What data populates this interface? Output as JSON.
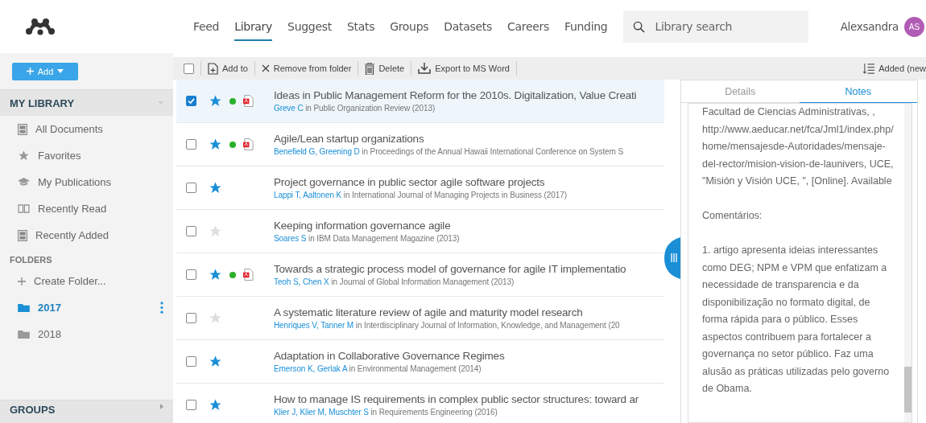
{
  "nav": {
    "items": [
      {
        "label": "Feed",
        "selected": false
      },
      {
        "label": "Library",
        "selected": true
      },
      {
        "label": "Suggest",
        "selected": false
      },
      {
        "label": "Stats",
        "selected": false
      },
      {
        "label": "Groups",
        "selected": false
      },
      {
        "label": "Datasets",
        "selected": false
      },
      {
        "label": "Careers",
        "selected": false
      },
      {
        "label": "Funding",
        "selected": false
      }
    ],
    "search": {
      "placeholder": "Library search"
    },
    "user": {
      "name": "Alexsandra",
      "initials": "AS"
    }
  },
  "add_button": "Add",
  "sidebar": {
    "my_library": {
      "title": "MY LIBRARY",
      "items": [
        "All Documents",
        "Favorites",
        "My Publications",
        "Recently Read",
        "Recently Added"
      ]
    },
    "folders": {
      "title": "FOLDERS",
      "create": "Create Folder...",
      "items": [
        {
          "label": "2017",
          "selected": true
        },
        {
          "label": "2018",
          "selected": false
        }
      ]
    },
    "groups": {
      "title": "GROUPS"
    }
  },
  "toolbar": {
    "select_all": {
      "checked": false
    },
    "actions": [
      "Add to",
      "Remove from folder",
      "Delete",
      "Export to MS Word"
    ],
    "sort": "Added (new"
  },
  "rows": [
    {
      "title": "Ideas in Public Management Reform for the 2010s. Digitalization, Value Creati",
      "authors": "Greve C",
      "source": "in Public Organization Review (2013)",
      "selected": true,
      "starred": true,
      "unread": true,
      "pdf": true
    },
    {
      "title": "Agile/Lean startup organizations",
      "authors": "Benefield G, Greening D",
      "source": "in Proceedings of the Annual Hawaii International Conference on System S",
      "selected": false,
      "starred": true,
      "unread": true,
      "pdf": true
    },
    {
      "title": "Project governance in public sector agile software projects",
      "authors": "Lappi T, Aaltonen K",
      "source": "in International Journal of Managing Projects in Business (2017)",
      "selected": false,
      "starred": true,
      "unread": false,
      "pdf": false
    },
    {
      "title": "Keeping information governance agile",
      "authors": "Soares S",
      "source": "in IBM Data Management Magazine (2013)",
      "selected": false,
      "starred": false,
      "unread": false,
      "pdf": false
    },
    {
      "title": "Towards a strategic process model of governance for agile IT implementatio",
      "authors": "Teoh S, Chen X",
      "source": "in Journal of Global Information Management (2013)",
      "selected": false,
      "starred": true,
      "unread": true,
      "pdf": true
    },
    {
      "title": "A systematic literature review of agile and maturity model research",
      "authors": "Henriques V, Tanner M",
      "source": "in Interdisciplinary Journal of Information, Knowledge, and Management (20",
      "selected": false,
      "starred": false,
      "unread": false,
      "pdf": false
    },
    {
      "title": "Adaptation in Collaborative Governance Regimes",
      "authors": "Emerson K, Gerlak A",
      "source": "in Environmental Management (2014)",
      "selected": false,
      "starred": true,
      "unread": false,
      "pdf": false
    },
    {
      "title": "How to manage IS requirements in complex public sector structures: toward ar",
      "authors": "Klier J, Klier M, Muschter S",
      "source": "in Requirements Engineering (2016)",
      "selected": false,
      "starred": true,
      "unread": false,
      "pdf": false
    }
  ],
  "panel": {
    "tabs": [
      {
        "label": "Details",
        "selected": false
      },
      {
        "label": "Notes",
        "selected": true
      }
    ],
    "notes": [
      "Facultad de Ciencias Administrativas, , http://www.aeducar.net/fca/Jml1/index.php/home/mensajesde-Autoridades/mensaje-del-rector/mision-vision-de-launivers, UCE, \"Misión y Visión UCE, \", [Online]. Available",
      "Comentários:",
      "1. artigo apresenta ideias interessantes como DEG; NPM e VPM que enfatizam a necessidade de transparencia e da disponibilização no formato digital, de forma rápida para o público. Esses aspectos contribuem para fortalecer a governança no setor público. Faz uma alusão as práticas utilizadas pelo governo de Obama."
    ]
  }
}
